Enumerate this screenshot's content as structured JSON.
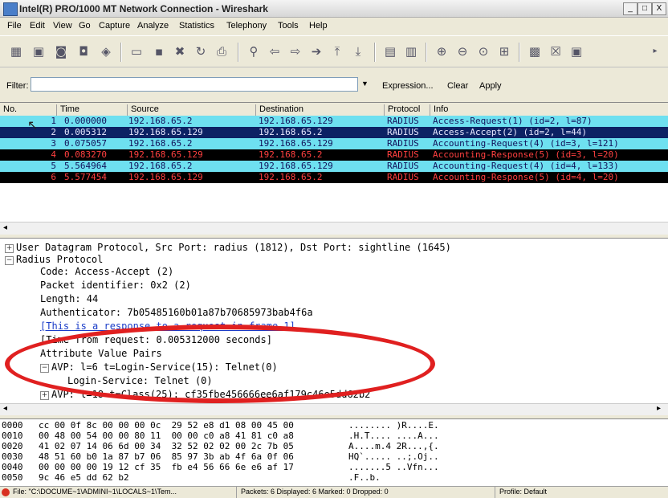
{
  "window": {
    "title": "Intel(R) PRO/1000 MT Network Connection - Wireshark",
    "min": "_",
    "restore": "□",
    "close": "X"
  },
  "menu": [
    "File",
    "Edit",
    "View",
    "Go",
    "Capture",
    "Analyze",
    "Statistics",
    "Telephony",
    "Tools",
    "Help"
  ],
  "filter": {
    "label": "Filter:",
    "value": "",
    "expression": "Expression...",
    "clear": "Clear",
    "apply": "Apply"
  },
  "columns": [
    "No.",
    "Time",
    "Source",
    "Destination",
    "Protocol",
    "Info"
  ],
  "packets": [
    {
      "no": "1",
      "time": "0.000000",
      "src": "192.168.65.2",
      "dst": "192.168.65.129",
      "proto": "RADIUS",
      "info": "Access-Request(1) (id=2, l=87)"
    },
    {
      "no": "2",
      "time": "0.005312",
      "src": "192.168.65.129",
      "dst": "192.168.65.2",
      "proto": "RADIUS",
      "info": "Access-Accept(2) (id=2, l=44)"
    },
    {
      "no": "3",
      "time": "0.075057",
      "src": "192.168.65.2",
      "dst": "192.168.65.129",
      "proto": "RADIUS",
      "info": "Accounting-Request(4) (id=3, l=121)"
    },
    {
      "no": "4",
      "time": "0.083270",
      "src": "192.168.65.129",
      "dst": "192.168.65.2",
      "proto": "RADIUS",
      "info": "Accounting-Response(5) (id=3, l=20)"
    },
    {
      "no": "5",
      "time": "5.564964",
      "src": "192.168.65.2",
      "dst": "192.168.65.129",
      "proto": "RADIUS",
      "info": "Accounting-Request(4) (id=4, l=133)"
    },
    {
      "no": "6",
      "time": "5.577454",
      "src": "192.168.65.129",
      "dst": "192.168.65.2",
      "proto": "RADIUS",
      "info": "Accounting-Response(5) (id=4, l=20)"
    }
  ],
  "details": {
    "udp": "User Datagram Protocol, Src Port: radius (1812), Dst Port: sightline (1645)",
    "radius": "Radius Protocol",
    "code": "Code: Access-Accept (2)",
    "packet_id": "Packet identifier: 0x2 (2)",
    "length": "Length: 44",
    "authenticator": "Authenticator: 7b05485160b01a87b70685973bab4f6a",
    "response_link": "[This is a response to a request in frame 1]",
    "time_from_request": "[Time from request: 0.005312000 seconds]",
    "avp_header": "Attribute Value Pairs",
    "avp1": "AVP: l=6  t=Login-Service(15): Telnet(0)",
    "login_service": "Login-Service: Telnet (0)",
    "avp2": "AVP: l=18  t=Class(25): cf35fbe456666ee6af179c46e5dd62b2"
  },
  "hex": [
    {
      "off": "0000",
      "bytes": "cc 00 0f 8c 00 00 00 0c  29 52 e8 d1 08 00 45 00",
      "ascii": "........ )R....E."
    },
    {
      "off": "0010",
      "bytes": "00 48 00 54 00 00 80 11  00 00 c0 a8 41 81 c0 a8",
      "ascii": ".H.T.... ....A..."
    },
    {
      "off": "0020",
      "bytes": "41 02 07 14 06 6d 00 34  32 52 02 02 00 2c 7b 05",
      "ascii": "A....m.4 2R...,{."
    },
    {
      "off": "0030",
      "bytes": "48 51 60 b0 1a 87 b7 06  85 97 3b ab 4f 6a 0f 06",
      "ascii": "HQ`..... ..;.Oj.."
    },
    {
      "off": "0040",
      "bytes": "00 00 00 00 19 12 cf 35  fb e4 56 66 6e e6 af 17",
      "ascii": ".......5 ..Vfn..."
    },
    {
      "off": "0050",
      "bytes": "9c 46 e5 dd 62 b2",
      "ascii": ".F..b."
    }
  ],
  "status": {
    "file": "File: \"C:\\DOCUME~1\\ADMINI~1\\LOCALS~1\\Tem...",
    "packets": "Packets: 6 Displayed: 6 Marked: 0 Dropped: 0",
    "profile": "Profile: Default"
  },
  "colors": {
    "cyan_row": "#6ee0f0",
    "selected_row": "#0c2264",
    "black_row": "#000000",
    "highlight_oval": "#e02020"
  }
}
